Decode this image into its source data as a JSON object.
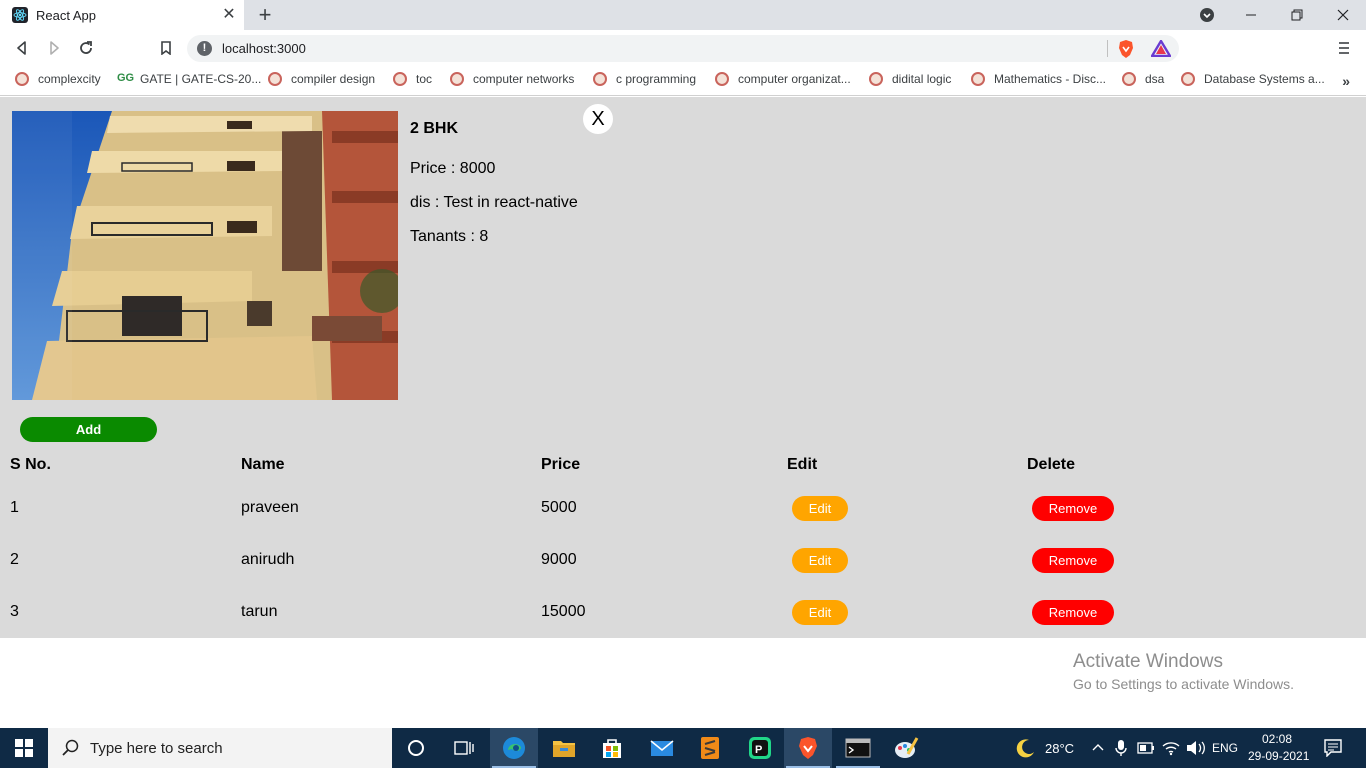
{
  "browser": {
    "tab_title": "React App",
    "tab_close": "✕",
    "new_tab": "+",
    "url": "localhost:3000",
    "bookmarks": [
      "complexcity",
      "GATE | GATE-CS-20...",
      "compiler design",
      "toc",
      "computer networks",
      "c programming",
      "computer organizat...",
      "didital logic",
      "Mathematics - Disc...",
      "dsa",
      "Database Systems a..."
    ],
    "bookmarks_more": "»"
  },
  "detail": {
    "title": "2 BHK",
    "price": "Price : 8000",
    "description": "dis : Test in react-native",
    "tenants": "Tanants : 8",
    "close": "X"
  },
  "add_label": "Add",
  "table": {
    "headers": [
      "S No.",
      "Name",
      "Price",
      "Edit",
      "Delete"
    ],
    "rows": [
      {
        "sno": "1",
        "name": "praveen",
        "price": "5000"
      },
      {
        "sno": "2",
        "name": "anirudh",
        "price": "9000"
      },
      {
        "sno": "3",
        "name": "tarun",
        "price": "15000"
      }
    ],
    "edit_label": "Edit",
    "remove_label": "Remove"
  },
  "watermark": {
    "line1": "Activate Windows",
    "line2": "Go to Settings to activate Windows."
  },
  "taskbar": {
    "search_placeholder": "Type here to search",
    "temperature": "28°C",
    "language": "ENG",
    "time": "02:08",
    "date": "29-09-2021"
  },
  "colors": {
    "page_bg": "#dadada",
    "add": "#0a8a00",
    "edit": "#ffa500",
    "remove": "#ff0000"
  }
}
